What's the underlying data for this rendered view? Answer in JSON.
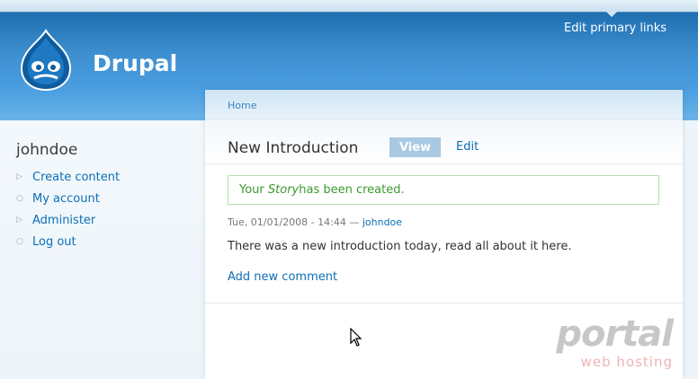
{
  "header": {
    "site_name": "Drupal",
    "primary_links_label": "Edit primary links",
    "logo_icon": "drupal-drop-icon"
  },
  "sidebar": {
    "username": "johndoe",
    "items": [
      {
        "label": "Create content",
        "marker": "triangle"
      },
      {
        "label": "My account",
        "marker": "circle"
      },
      {
        "label": "Administer",
        "marker": "triangle"
      },
      {
        "label": "Log out",
        "marker": "circle"
      }
    ]
  },
  "breadcrumb": {
    "home_label": "Home"
  },
  "node": {
    "title": "New Introduction",
    "tabs": {
      "view_label": "View",
      "edit_label": "Edit",
      "active": "View"
    },
    "status": {
      "prefix": "Your ",
      "type": "Story",
      "suffix": " has been created."
    },
    "submitted": {
      "date": "Tue, 01/01/2008 - 14:44 — ",
      "author": "johndoe"
    },
    "body": "There was a new introduction today, read all about it here.",
    "add_comment_label": "Add new comment"
  },
  "watermark": {
    "brand": "portal",
    "sub": "web hosting"
  },
  "colors": {
    "link": "#0b6fb5",
    "header_blue": "#3d8fd0",
    "status_green": "#3a9a2f"
  }
}
